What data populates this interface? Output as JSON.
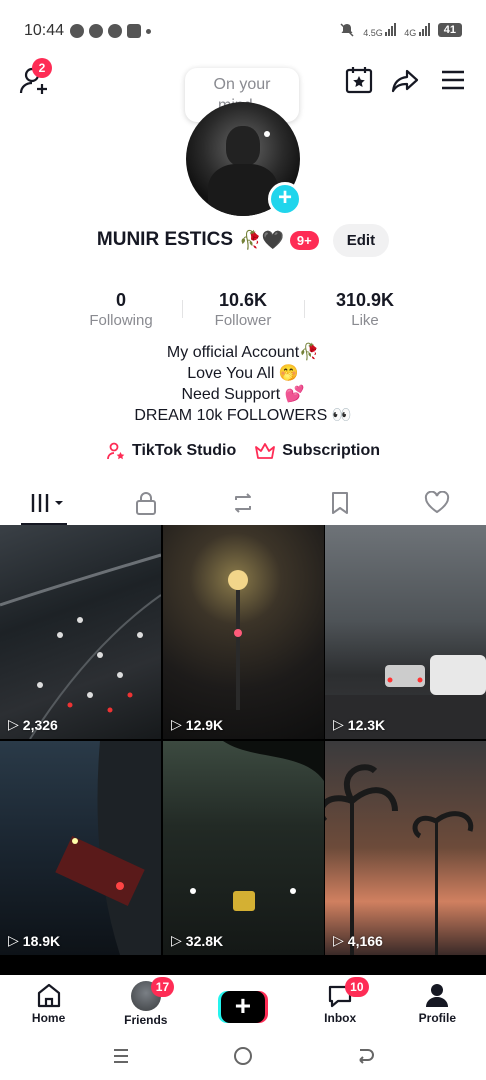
{
  "status_bar": {
    "time": "10:44",
    "net1": "4.5G",
    "net2": "4G",
    "battery": "41"
  },
  "header": {
    "friend_requests_badge": "2",
    "mind_bubble": "On your mind..."
  },
  "profile": {
    "username": "MUNIR ESTICS",
    "name_emojis": "🥀🖤",
    "badge": "9+",
    "edit_label": "Edit"
  },
  "stats": [
    {
      "value": "0",
      "label": "Following"
    },
    {
      "value": "10.6K",
      "label": "Follower"
    },
    {
      "value": "310.9K",
      "label": "Like"
    }
  ],
  "bio": [
    "My official Account🥀",
    "Love You All 🤭",
    "Need Support 💕",
    "DREAM 10k FOLLOWERS 👀"
  ],
  "links": {
    "studio": "TikTok Studio",
    "subscription": "Subscription"
  },
  "videos": [
    {
      "views": "2,326"
    },
    {
      "views": "12.9K"
    },
    {
      "views": "12.3K"
    },
    {
      "views": "18.9K"
    },
    {
      "views": "32.8K"
    },
    {
      "views": "4,166"
    }
  ],
  "bottom_nav": {
    "home": "Home",
    "friends": "Friends",
    "friends_badge": "17",
    "inbox": "Inbox",
    "inbox_badge": "10",
    "profile": "Profile"
  },
  "colors": {
    "accent": "#fe2c55",
    "cyan": "#20d5ec"
  }
}
